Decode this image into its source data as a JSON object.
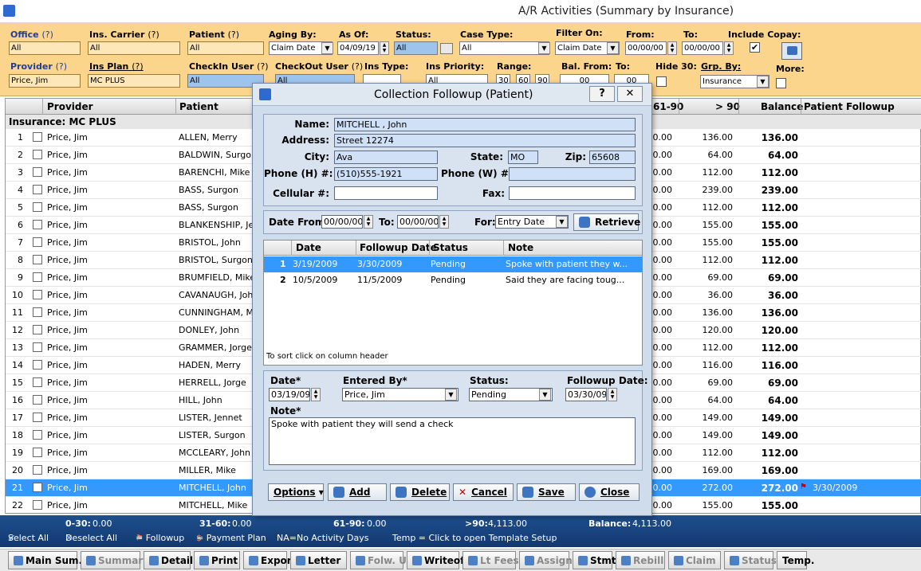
{
  "window": {
    "title": "A/R Activities  (Summary by Insurance)"
  },
  "filters": {
    "office": {
      "label": "Office",
      "q": "(?)",
      "value": "All"
    },
    "ins_carrier": {
      "label": "Ins. Carrier",
      "q": "(?)",
      "value": "All"
    },
    "patient": {
      "label": "Patient",
      "q": "(?)",
      "value": "All"
    },
    "aging_by": {
      "label": "Aging By:",
      "value": "Claim Date"
    },
    "as_of": {
      "label": "As Of:",
      "value": "04/09/19"
    },
    "status": {
      "label": "Status:",
      "value": "All"
    },
    "case_type": {
      "label": "Case Type:",
      "value": "All"
    },
    "filter_on": {
      "label": "Filter On:",
      "value": "Claim Date"
    },
    "from": {
      "label": "From:",
      "value": "00/00/00"
    },
    "to": {
      "label": "To:",
      "value": "00/00/00"
    },
    "include_copay": {
      "label": "Include Copay:",
      "checked": "✔"
    },
    "provider": {
      "label": "Provider",
      "q": "(?)",
      "value": "Price, Jim"
    },
    "ins_plan": {
      "label": "Ins Plan",
      "q": "(?)",
      "value": "MC PLUS"
    },
    "checkin_user": {
      "label": "CheckIn User",
      "q": "(?)",
      "value": "All"
    },
    "checkout_user": {
      "label": "CheckOut User",
      "q": "(?)",
      "value": "All"
    },
    "ins_type": {
      "label": "Ins Type:",
      "value": ""
    },
    "ins_priority": {
      "label": "Ins Priority:",
      "value": "All"
    },
    "range": {
      "label": "Range:",
      "values": [
        "30",
        "60",
        "90"
      ]
    },
    "bal_from": {
      "label": "Bal. From:",
      "value": "00"
    },
    "bal_to": {
      "label": "To:",
      "value": "00"
    },
    "hide30": {
      "label": "Hide 30:"
    },
    "grp_by": {
      "label": "Grp. By:",
      "value": "Insurance"
    },
    "more": {
      "label": "More:"
    }
  },
  "grid": {
    "headers": {
      "provider": "Provider",
      "patient": "Patient",
      "c6190": "61-90",
      "c90": "> 90",
      "balance": "Balance",
      "followup": "Patient Followup"
    },
    "group": "Insurance: MC PLUS",
    "rows": [
      {
        "n": "1",
        "provider": "Price, Jim",
        "patient": "ALLEN, Merry",
        "a": "0.00",
        "b": "136.00",
        "bal": "136.00",
        "fu": ""
      },
      {
        "n": "2",
        "provider": "Price, Jim",
        "patient": "BALDWIN, Surgon",
        "a": "0.00",
        "b": "64.00",
        "bal": "64.00",
        "fu": ""
      },
      {
        "n": "3",
        "provider": "Price, Jim",
        "patient": "BARENCHI, Mike",
        "a": "0.00",
        "b": "112.00",
        "bal": "112.00",
        "fu": ""
      },
      {
        "n": "4",
        "provider": "Price, Jim",
        "patient": "BASS, Surgon",
        "a": "0.00",
        "b": "239.00",
        "bal": "239.00",
        "fu": ""
      },
      {
        "n": "5",
        "provider": "Price, Jim",
        "patient": "BASS, Surgon",
        "a": "0.00",
        "b": "112.00",
        "bal": "112.00",
        "fu": ""
      },
      {
        "n": "6",
        "provider": "Price, Jim",
        "patient": "BLANKENSHIP, Je",
        "a": "0.00",
        "b": "155.00",
        "bal": "155.00",
        "fu": ""
      },
      {
        "n": "7",
        "provider": "Price, Jim",
        "patient": "BRISTOL, John",
        "a": "0.00",
        "b": "155.00",
        "bal": "155.00",
        "fu": ""
      },
      {
        "n": "8",
        "provider": "Price, Jim",
        "patient": "BRISTOL, Surgon",
        "a": "0.00",
        "b": "112.00",
        "bal": "112.00",
        "fu": ""
      },
      {
        "n": "9",
        "provider": "Price, Jim",
        "patient": "BRUMFIELD, Mike",
        "a": "0.00",
        "b": "69.00",
        "bal": "69.00",
        "fu": ""
      },
      {
        "n": "10",
        "provider": "Price, Jim",
        "patient": "CAVANAUGH, John",
        "a": "0.00",
        "b": "36.00",
        "bal": "36.00",
        "fu": ""
      },
      {
        "n": "11",
        "provider": "Price, Jim",
        "patient": "CUNNINGHAM, Me",
        "a": "0.00",
        "b": "136.00",
        "bal": "136.00",
        "fu": ""
      },
      {
        "n": "12",
        "provider": "Price, Jim",
        "patient": "DONLEY, John",
        "a": "0.00",
        "b": "120.00",
        "bal": "120.00",
        "fu": ""
      },
      {
        "n": "13",
        "provider": "Price, Jim",
        "patient": "GRAMMER, Jorge",
        "a": "0.00",
        "b": "112.00",
        "bal": "112.00",
        "fu": ""
      },
      {
        "n": "14",
        "provider": "Price, Jim",
        "patient": "HADEN, Merry",
        "a": "0.00",
        "b": "116.00",
        "bal": "116.00",
        "fu": ""
      },
      {
        "n": "15",
        "provider": "Price, Jim",
        "patient": "HERRELL, Jorge",
        "a": "0.00",
        "b": "69.00",
        "bal": "69.00",
        "fu": ""
      },
      {
        "n": "16",
        "provider": "Price, Jim",
        "patient": "HILL, John",
        "a": "0.00",
        "b": "64.00",
        "bal": "64.00",
        "fu": ""
      },
      {
        "n": "17",
        "provider": "Price, Jim",
        "patient": "LISTER, Jennet",
        "a": "0.00",
        "b": "149.00",
        "bal": "149.00",
        "fu": ""
      },
      {
        "n": "18",
        "provider": "Price, Jim",
        "patient": "LISTER, Surgon",
        "a": "0.00",
        "b": "149.00",
        "bal": "149.00",
        "fu": ""
      },
      {
        "n": "19",
        "provider": "Price, Jim",
        "patient": "MCCLEARY, John",
        "a": "0.00",
        "b": "112.00",
        "bal": "112.00",
        "fu": ""
      },
      {
        "n": "20",
        "provider": "Price, Jim",
        "patient": "MILLER, Mike",
        "a": "0.00",
        "b": "169.00",
        "bal": "169.00",
        "fu": ""
      },
      {
        "n": "21",
        "provider": "Price, Jim",
        "patient": "MITCHELL, John",
        "a": "0.00",
        "b": "272.00",
        "bal": "272.00",
        "fu": "3/30/2009",
        "selected": true
      },
      {
        "n": "22",
        "provider": "Price, Jim",
        "patient": "MITCHELL, Mike",
        "a": "0.00",
        "b": "155.00",
        "bal": "155.00",
        "fu": ""
      }
    ]
  },
  "totals": {
    "t0_30": {
      "label": "0-30:",
      "value": "0.00"
    },
    "t31_60": {
      "label": "31-60:",
      "value": "0.00"
    },
    "t61_90": {
      "label": "61-90:",
      "value": "0.00"
    },
    "t90": {
      "label": ">90:",
      "value": "4,113.00"
    },
    "balance": {
      "label": "Balance:",
      "value": "4,113.00"
    },
    "legend": {
      "select_all": "Select All",
      "deselect_all": "Deselect All",
      "followup": "= Followup",
      "payment_plan": "= Payment Plan",
      "na": "NA=No Activity Days",
      "temp": "Temp = Click to open Template Setup"
    }
  },
  "toolbar": [
    "Main Sum.",
    "Summary",
    "Detail",
    "Print",
    "Export",
    "Letter",
    "Folw. Up",
    "Writeoff",
    "Lt Fees",
    "Assign",
    "Stmts",
    "Rebill",
    "Claim",
    "Status",
    "Temp."
  ],
  "dialog": {
    "title": "Collection Followup (Patient)",
    "help": "?",
    "close": "✕",
    "name": {
      "label": "Name:",
      "value": "MITCHELL , John"
    },
    "address": {
      "label": "Address:",
      "value": "Street 12274"
    },
    "city": {
      "label": "City:",
      "value": "Ava"
    },
    "state": {
      "label": "State:",
      "value": "MO"
    },
    "zip": {
      "label": "Zip:",
      "value": "65608"
    },
    "phone_h": {
      "label": "Phone (H) #:",
      "value": "(510)555-1921"
    },
    "phone_w": {
      "label": "Phone (W) #:",
      "value": ""
    },
    "cellular": {
      "label": "Cellular #:",
      "value": ""
    },
    "fax": {
      "label": "Fax:",
      "value": ""
    },
    "date_from": {
      "label": "Date From:",
      "value": "00/00/00"
    },
    "date_to": {
      "label": "To:",
      "value": "00/00/00"
    },
    "for": {
      "label": "For:",
      "value": "Entry Date"
    },
    "retrieve": "Retrieve",
    "fgrid": {
      "headers": {
        "date": "Date",
        "fdate": "Followup Date",
        "status": "Status",
        "note": "Note"
      },
      "rows": [
        {
          "n": "1",
          "date": "3/19/2009",
          "fdate": "3/30/2009",
          "status": "Pending",
          "note": "Spoke with patient they w...",
          "selected": true
        },
        {
          "n": "2",
          "date": "10/5/2009",
          "fdate": "11/5/2009",
          "status": "Pending",
          "note": "Said they are facing toug..."
        }
      ],
      "sort_hint": "To sort click on column header"
    },
    "edit": {
      "date": {
        "label": "Date*",
        "value": "03/19/09"
      },
      "entered_by": {
        "label": "Entered By*",
        "value": "Price, Jim"
      },
      "status": {
        "label": "Status:",
        "value": "Pending"
      },
      "followup_date": {
        "label": "Followup Date:",
        "value": "03/30/09"
      },
      "note": {
        "label": "Note*",
        "value": "Spoke with patient they will send a check"
      }
    },
    "buttons": {
      "options": "Options",
      "add": "Add",
      "delete": "Delete",
      "cancel": "Cancel",
      "save": "Save",
      "close": "Close"
    }
  }
}
